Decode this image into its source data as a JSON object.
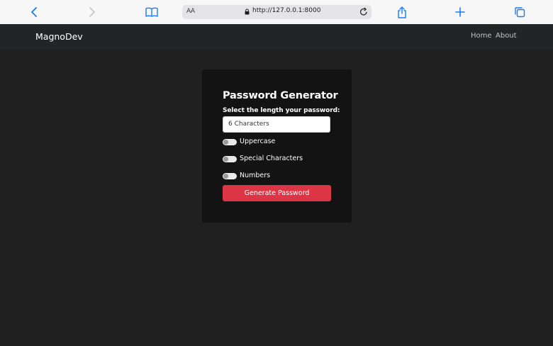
{
  "browser": {
    "text_size_label": "AA",
    "url": "http://127.0.0.1:8000",
    "accent_color": "#1a7cf5"
  },
  "navbar": {
    "brand": "MagnoDev",
    "links": [
      "Home",
      "About"
    ]
  },
  "generator": {
    "title": "Password Generator",
    "length_label": "Select the length your password:",
    "length_value": "6 Characters",
    "options": [
      {
        "label": "Uppercase",
        "checked": false
      },
      {
        "label": "Special Characters",
        "checked": false
      },
      {
        "label": "Numbers",
        "checked": false
      }
    ],
    "generate_label": "Generate Password",
    "button_color": "#dc3545"
  }
}
